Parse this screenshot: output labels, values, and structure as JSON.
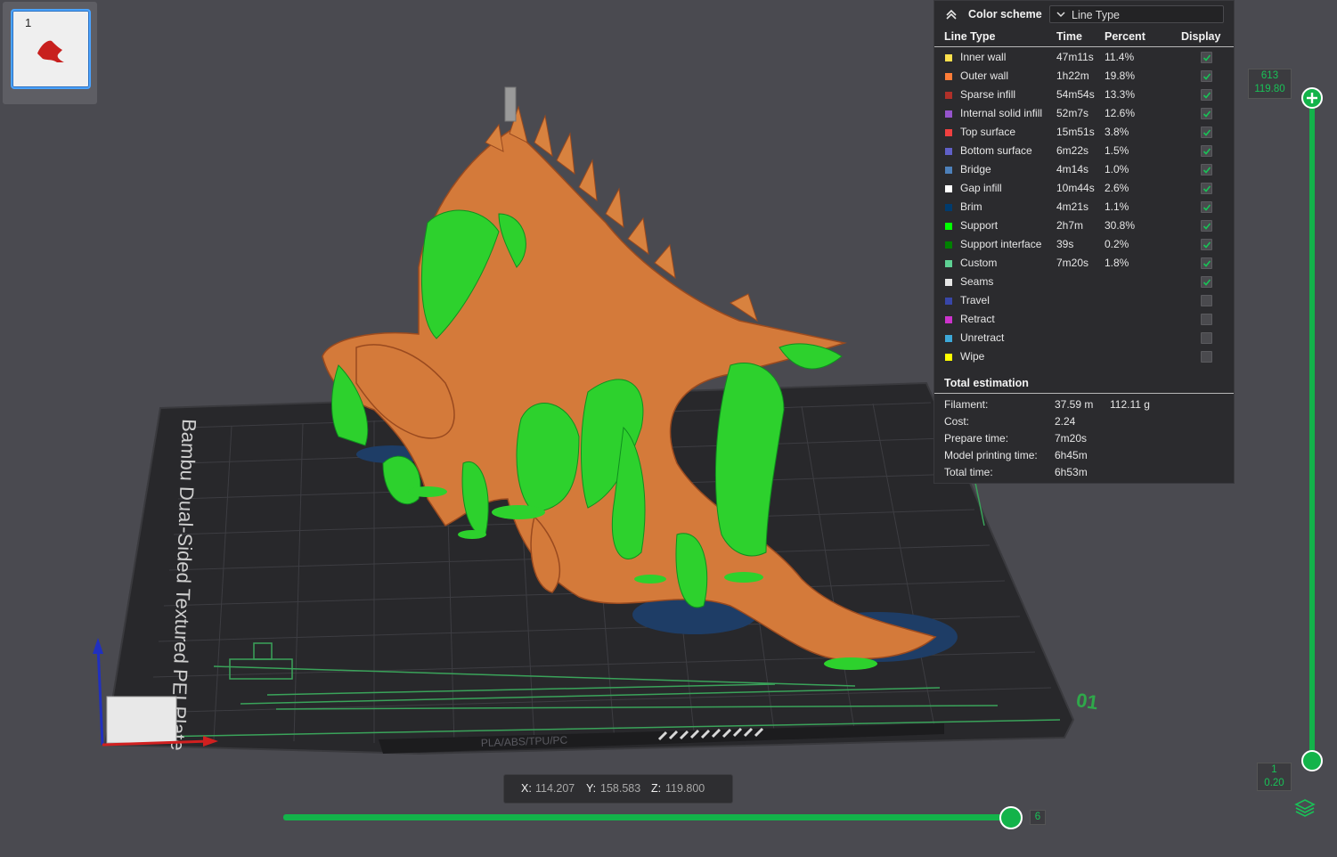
{
  "plate": {
    "number": "1"
  },
  "legend": {
    "scheme_label": "Color scheme",
    "scheme_value": "Line Type",
    "columns": {
      "line_type": "Line Type",
      "time": "Time",
      "percent": "Percent",
      "display": "Display"
    },
    "rows": [
      {
        "name": "Inner wall",
        "time": "47m11s",
        "percent": "11.4%",
        "color": "#ffe14d",
        "display": true
      },
      {
        "name": "Outer wall",
        "time": "1h22m",
        "percent": "19.8%",
        "color": "#ff7d38",
        "display": true
      },
      {
        "name": "Sparse infill",
        "time": "54m54s",
        "percent": "13.3%",
        "color": "#b03029",
        "display": true
      },
      {
        "name": "Internal solid infill",
        "time": "52m7s",
        "percent": "12.6%",
        "color": "#9654cc",
        "display": true
      },
      {
        "name": "Top surface",
        "time": "15m51s",
        "percent": "3.8%",
        "color": "#f04040",
        "display": true
      },
      {
        "name": "Bottom surface",
        "time": "6m22s",
        "percent": "1.5%",
        "color": "#6060c8",
        "display": true
      },
      {
        "name": "Bridge",
        "time": "4m14s",
        "percent": "1.0%",
        "color": "#4d80ba",
        "display": true
      },
      {
        "name": "Gap infill",
        "time": "10m44s",
        "percent": "2.6%",
        "color": "#ffffff",
        "display": true
      },
      {
        "name": "Brim",
        "time": "4m21s",
        "percent": "1.1%",
        "color": "#003b6e",
        "display": true
      },
      {
        "name": "Support",
        "time": "2h7m",
        "percent": "30.8%",
        "color": "#00ff00",
        "display": true
      },
      {
        "name": "Support interface",
        "time": "39s",
        "percent": "0.2%",
        "color": "#008000",
        "display": true
      },
      {
        "name": "Custom",
        "time": "7m20s",
        "percent": "1.8%",
        "color": "#5ed194",
        "display": true
      },
      {
        "name": "Seams",
        "time": "",
        "percent": "",
        "color": "#e6e6e6",
        "display": true
      },
      {
        "name": "Travel",
        "time": "",
        "percent": "",
        "color": "#3846a8",
        "display": false
      },
      {
        "name": "Retract",
        "time": "",
        "percent": "",
        "color": "#cc33cc",
        "display": false
      },
      {
        "name": "Unretract",
        "time": "",
        "percent": "",
        "color": "#3da8d8",
        "display": false
      },
      {
        "name": "Wipe",
        "time": "",
        "percent": "",
        "color": "#ffff00",
        "display": false
      }
    ],
    "total": {
      "title": "Total estimation",
      "items": [
        {
          "key": "Filament:",
          "value": "37.59 m",
          "value2": "112.11 g"
        },
        {
          "key": "Cost:",
          "value": "2.24",
          "value2": ""
        },
        {
          "key": "Prepare time:",
          "value": "7m20s",
          "value2": ""
        },
        {
          "key": "Model printing time:",
          "value": "6h45m",
          "value2": ""
        },
        {
          "key": "Total time:",
          "value": "6h53m",
          "value2": ""
        }
      ]
    }
  },
  "layer_slider": {
    "top_layer": "613",
    "top_height": "119.80",
    "bottom_layer": "1",
    "bottom_height": "0.20"
  },
  "move_slider": {
    "value": "6"
  },
  "coords": {
    "x_label": "X:",
    "x": "114.207",
    "y_label": "Y:",
    "y": "158.583",
    "z_label": "Z:",
    "z": "119.800"
  },
  "plate_bed": {
    "title": "Bambu Dual-Sided Textured PEI Plate",
    "footer": "PLA/ABS/TPU/PC",
    "number": "01"
  },
  "colors": {
    "accent_green": "#13b34a",
    "model_orange": "#d47a3a",
    "support_green": "#2dd12d",
    "bed": "#28282b"
  }
}
